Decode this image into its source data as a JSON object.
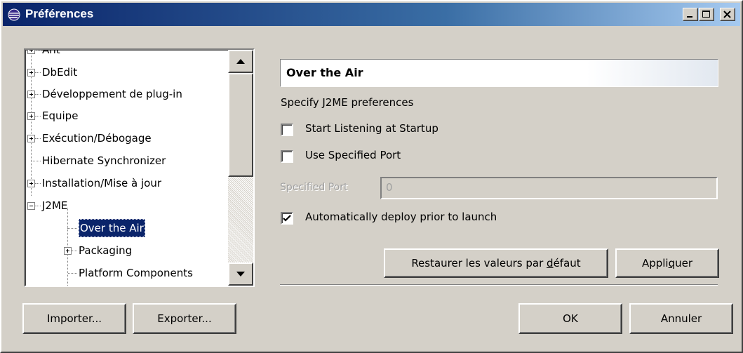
{
  "window": {
    "title": "Préférences",
    "controls": {
      "minimize": "minimize-icon",
      "maximize": "maximize-icon",
      "close": "close-icon"
    }
  },
  "tree": {
    "items": [
      {
        "label": "Ant",
        "expandable": true,
        "level": 0
      },
      {
        "label": "DbEdit",
        "expandable": true,
        "level": 0
      },
      {
        "label": "Développement de plug-in",
        "expandable": true,
        "level": 0
      },
      {
        "label": "Equipe",
        "expandable": true,
        "level": 0
      },
      {
        "label": "Exécution/Débogage",
        "expandable": true,
        "level": 0
      },
      {
        "label": "Hibernate Synchronizer",
        "expandable": false,
        "level": 0
      },
      {
        "label": "Installation/Mise à jour",
        "expandable": true,
        "level": 0
      },
      {
        "label": "J2ME",
        "expandable": true,
        "expanded": true,
        "level": 0
      },
      {
        "label": "Over the Air",
        "expandable": false,
        "level": 1,
        "selected": true
      },
      {
        "label": "Packaging",
        "expandable": true,
        "level": 1
      },
      {
        "label": "Platform Components",
        "expandable": false,
        "level": 1
      }
    ]
  },
  "page": {
    "title": "Over the Air",
    "description": "Specify J2ME preferences",
    "start_listening_label": "Start Listening at Startup",
    "start_listening_checked": false,
    "use_port_label": "Use Specified Port",
    "use_port_checked": false,
    "specified_port_label": "Specified Port",
    "specified_port_value": "0",
    "auto_deploy_label": "Automatically deploy prior to launch",
    "auto_deploy_checked": true,
    "restore_defaults_prefix": "Restaurer les valeurs par ",
    "restore_defaults_mnemonic": "d",
    "restore_defaults_suffix": "éfaut",
    "apply_prefix": "Appli",
    "apply_mnemonic": "q",
    "apply_suffix": "uer"
  },
  "footer": {
    "import_label": "Importer...",
    "export_label": "Exporter...",
    "ok_label": "OK",
    "cancel_label": "Annuler"
  },
  "colors": {
    "title_start": "#0a246a",
    "title_end": "#a6caf0",
    "selection": "#0a246a",
    "face": "#d4d0c8"
  }
}
